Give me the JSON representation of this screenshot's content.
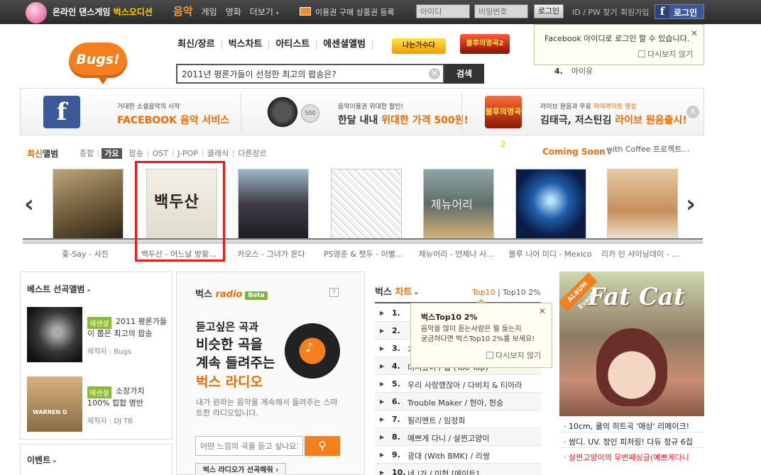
{
  "topbar": {
    "game_prefix": "온라인 댄스게임",
    "game_name": "벅스오디션",
    "nav": [
      "음악",
      "게임",
      "영화",
      "더보기"
    ],
    "more_caret": "▾",
    "ticket": "이용권 구매  상품권 등록",
    "id_placeholder": "아이디",
    "pw_placeholder": "비밀번호",
    "login": "로그인",
    "find": "ID / PW 찾기",
    "join": "회원가입",
    "fb_login": "로그인"
  },
  "header": {
    "logo": "Bugs!",
    "nav": [
      "최신/장르",
      "벅스차트",
      "아티스트",
      "에센셜앨범"
    ],
    "badge_singer": "나는가수다",
    "badge_immortal": "불후의명곡2",
    "search_value": "2011년 평론가들이 선정한 최고의 팝송은?",
    "search_button": "검색"
  },
  "fb_popup": {
    "message": "Facebook 아이디로 로그인 할 수 있습니다.",
    "no_more": "다시보지 않기",
    "under_rank": "4.",
    "under_text": "아이유"
  },
  "banners": [
    {
      "small": "거대한 소셜음악의 시작",
      "big": "FACEBOOK 음악 서비스"
    },
    {
      "small": "음악이용권 위대한 할인!",
      "big_dark": "한달 내내 ",
      "big": "위대한 가격 500원!",
      "badge": "500"
    },
    {
      "small_dark": "라이브 원음과 무료 ",
      "small": "하이라이트 영상",
      "big_dark": "김태극, 저스틴김 ",
      "big": "라이브 원음출시!"
    }
  ],
  "latest": {
    "title_or": "최신",
    "title": "앨범",
    "genres": [
      "종합",
      "가요",
      "팝송",
      "OST",
      "J-POP",
      "클래식",
      "다른장르"
    ],
    "coming_soon": "Coming Soon",
    "coming_text": "with Coffee 프로젝트…",
    "albums": [
      {
        "title": "줒-Say - 사진"
      },
      {
        "title": "백두산 - 어느날 방황…",
        "cover_text": "백두산"
      },
      {
        "title": "카오스 - 그녀가 온다"
      },
      {
        "title": "PS영준 & 팻두 - 이별…"
      },
      {
        "title": "제뉴어리 - 언제나 사…",
        "cover_text": "제뉴어리"
      },
      {
        "title": "블루 니어 미디 - Mexico"
      },
      {
        "title": "리카 인 샤이닝데이 - …"
      }
    ]
  },
  "best": {
    "title": "베스트 선곡앨범",
    "badge": "에센셜",
    "items": [
      {
        "name": "2011 평론가들이 뽑은 최고의 팝송",
        "maker": "제작자 : Bugs"
      },
      {
        "name": "소장가치 100% 힙합 명반",
        "maker": "제작자 : DJ TB",
        "thumb_label": "WARREN G"
      }
    ],
    "event_title": "이벤트"
  },
  "radio": {
    "brand": "벅스",
    "brand_radio": "radio",
    "beta": "Beta",
    "help": "?",
    "line1": "듣고싶은 곡과",
    "line2": "비슷한 곡을",
    "line3": "계속 들려주는",
    "line4": "벅스 라디오",
    "desc": "내가 원하는 음악을 계속해서 들려주는 스마트한 라디오입니다.",
    "input_placeholder": "어떤 느낌의 곡을 듣고 싶나요?",
    "pick": "벅스 라디오가 선곡해줘"
  },
  "chart": {
    "title": "벅스",
    "title_or": "차트",
    "tab1": "Top10",
    "tab2": "Top10 2%",
    "rows": [
      {
        "rank": "1.",
        "song": ""
      },
      {
        "rank": "2.",
        "song": ""
      },
      {
        "rank": "3.",
        "song": "가"
      },
      {
        "rank": "4.",
        "song": "미쳐봤어 / 탑 (Too Top)"
      },
      {
        "rank": "5.",
        "song": "우리 사랑했잖아 / 다비치 & 티아라"
      },
      {
        "rank": "6.",
        "song": "Trouble Maker / 현아, 현승"
      },
      {
        "rank": "7.",
        "song": "필리멘트 / 임정희"
      },
      {
        "rank": "8.",
        "song": "예쁘게 다니 / 살찐고양이"
      },
      {
        "rank": "9.",
        "song": "광대 (With BMK) / 리쌍"
      },
      {
        "rank": "10.",
        "song": "네 |가 / 미혁 [에이트]"
      }
    ]
  },
  "top10_popup": {
    "title": "벅스Top10 2%",
    "desc1": "음악을 많이 듣는사람은 뭘 들는지",
    "desc2": "궁금하다면 벅스Top10 2%를 보세요!",
    "no_more": "다시보지 않기"
  },
  "event_ad": {
    "ribbon": "ALBUM Event",
    "title": "Fat Cat",
    "items": [
      "10cm, 쿨의 히트곡 '애상' 리메이크!",
      "쌈디. UV. 정인 피처링! 다듀 정규 6집",
      "살찐고양이의 무번째싱글(예쁘게다니"
    ]
  }
}
